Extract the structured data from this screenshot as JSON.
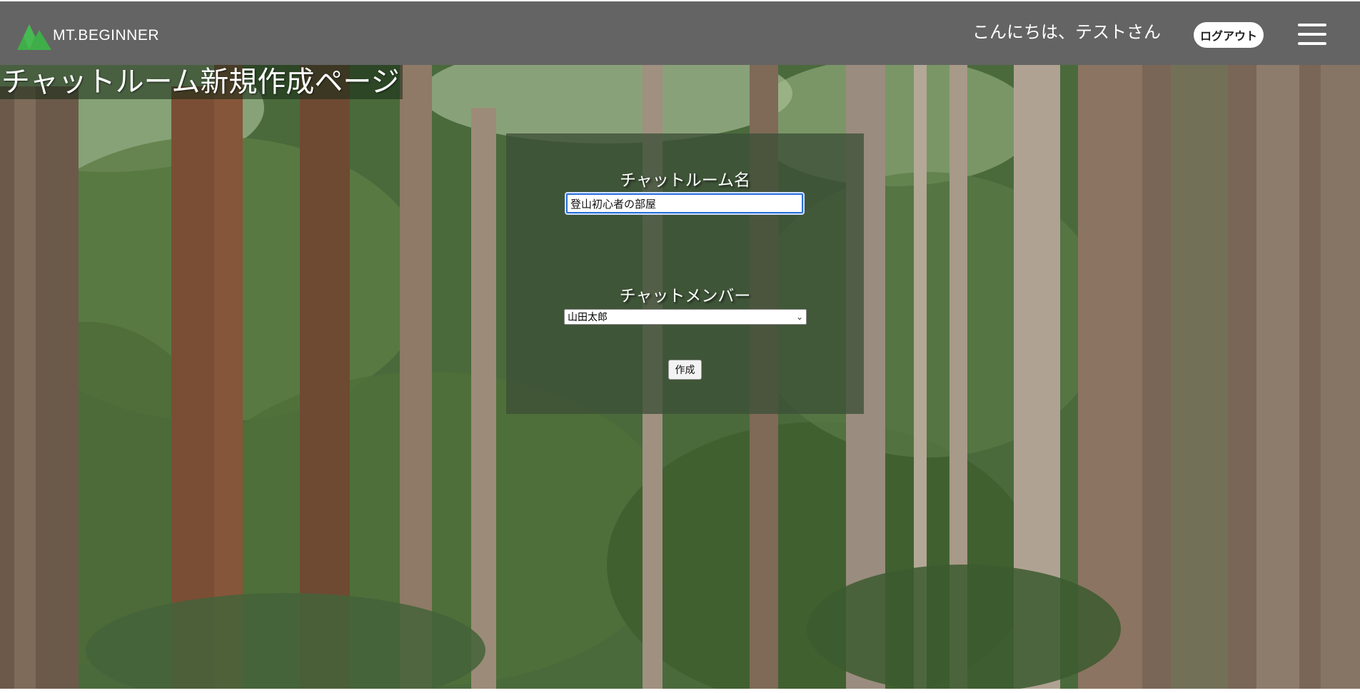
{
  "header": {
    "brand": "MT.BEGINNER",
    "greeting": "こんにちは、テストさん",
    "logout_label": "ログアウト",
    "menu_icon": "hamburger-menu-icon",
    "background_color": "#646464",
    "logo_color": "#3fae49"
  },
  "page": {
    "title": "チャットルーム新規作成ページ",
    "background": "forest-photo"
  },
  "form": {
    "room_name_label": "チャットルーム名",
    "room_name_value": "登山初心者の部屋",
    "member_label": "チャットメンバー",
    "member_selected": "山田太郎",
    "submit_label": "作成"
  }
}
